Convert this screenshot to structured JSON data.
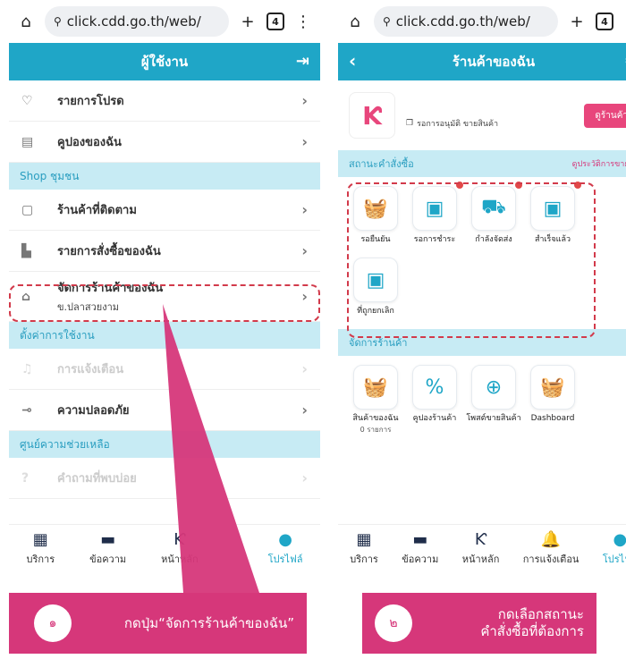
{
  "browser": {
    "url": "click.cdd.go.th/web/",
    "tabs": "4",
    "settings_icon": "tune-icon"
  },
  "left": {
    "title": "ผู้ใช้งาน",
    "items_top": [
      {
        "label": "รายการโปรด",
        "icon": "heart-icon"
      },
      {
        "label": "คูปองของฉัน",
        "icon": "coupon-icon"
      }
    ],
    "section_shop": "Shop ชุมชน",
    "items_shop": [
      {
        "label": "ร้านค้าที่ติดตาม",
        "icon": "bag-icon"
      },
      {
        "label": "รายการสั่งซื้อของฉัน",
        "icon": "receipt-icon"
      }
    ],
    "manage_shop": {
      "label": "จัดการร้านค้าของฉัน",
      "sub": "ข.ปลาสวยงาม",
      "icon": "home-icon"
    },
    "section_settings": "ตั้งค่าการใช้งาน",
    "items_settings": [
      {
        "label": "การแจ้งเตือน",
        "icon": "bell-icon"
      },
      {
        "label": "ความปลอดภัย",
        "icon": "key-icon"
      }
    ],
    "section_help": "ศูนย์ความช่วยเหลือ",
    "items_help": [
      {
        "label": "คำถามที่พบบ่อย",
        "icon": "question-icon"
      }
    ],
    "nav": [
      "บริการ",
      "ข้อความ",
      "หน้าหลัก",
      "",
      "โปรไฟล์"
    ]
  },
  "right": {
    "title": "ร้านค้าของฉัน",
    "shop_status": "รอการอนุมัติ ขายสินค้า",
    "shop_button": "ดูร้านค้า",
    "section_orders": "สถานะคำสั่งซื้อ",
    "orders_link": "ดูประวัติการขาย >",
    "orders": [
      {
        "label": "รอยืนยัน",
        "icon": "basket-clock-icon",
        "dot": false
      },
      {
        "label": "รอการชำระ",
        "icon": "box-minus-icon",
        "dot": true
      },
      {
        "label": "กำลังจัดส่ง",
        "icon": "truck-icon",
        "dot": true
      },
      {
        "label": "สำเร็จแล้ว",
        "icon": "box-check-icon",
        "dot": true
      },
      {
        "label": "ที่ถูกยกเลิก",
        "icon": "box-cancel-icon",
        "dot": false
      }
    ],
    "section_manage": "จัดการร้านค้า",
    "manage": [
      {
        "label": "สินค้าของฉัน",
        "sub": "0 รายการ",
        "icon": "basket-icon"
      },
      {
        "label": "คูปองร้านค้า",
        "sub": "",
        "icon": "coupon-icon"
      },
      {
        "label": "โพสต์ขายสินค้า",
        "sub": "",
        "icon": "plus-circle-icon"
      },
      {
        "label": "Dashboard",
        "sub": "",
        "icon": "dashboard-icon"
      }
    ],
    "nav": [
      "บริการ",
      "ข้อความ",
      "หน้าหลัก",
      "การแจ้งเตือน",
      "โปรไฟล์"
    ]
  },
  "captions": [
    {
      "num": "๑",
      "text": "กดปุ่ม“จัดการร้านค้าของฉัน”"
    },
    {
      "num": "๒",
      "text_line1": "กดเลือกสถานะ",
      "text_line2": "คำสั่งซื้อที่ต้องการ"
    }
  ],
  "colors": {
    "primary": "#1fa6c7",
    "accent": "#d6377a",
    "dash": "#d23a4b"
  }
}
